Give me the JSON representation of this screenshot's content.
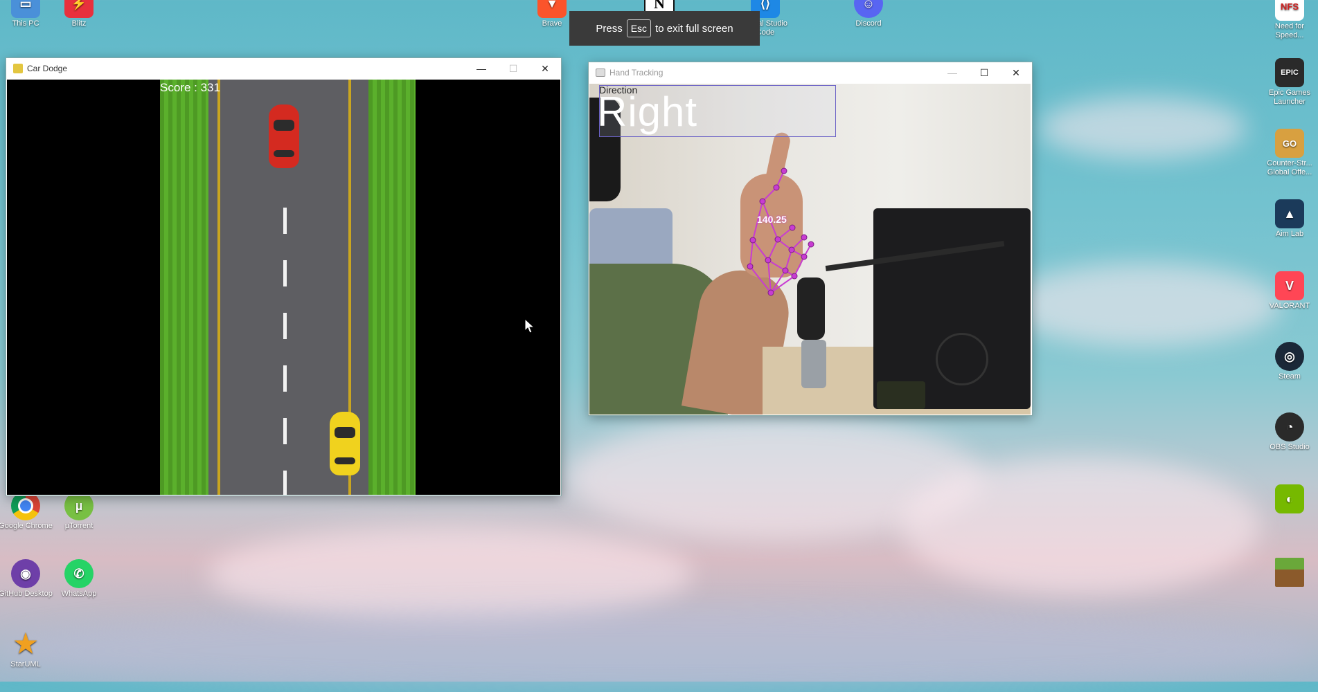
{
  "toast": {
    "press": "Press",
    "key": "Esc",
    "text": "to exit full screen"
  },
  "desktop_icons_left": [
    {
      "label": "This PC",
      "icon": "computer-icon"
    },
    {
      "label": "Blitz",
      "icon": "blitz-icon"
    },
    {
      "label": "Google Chrome",
      "icon": "chrome-icon"
    },
    {
      "label": "µTorrent",
      "icon": "utorrent-icon"
    },
    {
      "label": "GitHub Desktop",
      "icon": "github-icon"
    },
    {
      "label": "WhatsApp",
      "icon": "whatsapp-icon"
    },
    {
      "label": "StarUML",
      "icon": "staruml-icon"
    }
  ],
  "desktop_icons_top": [
    {
      "label": "Brave",
      "icon": "brave-icon"
    },
    {
      "label": "Visual Studio Code",
      "icon": "vscode-icon"
    },
    {
      "label": "Discord",
      "icon": "discord-icon"
    }
  ],
  "desktop_icons_right": [
    {
      "label": "Need for Speed...",
      "icon": "nfs-icon"
    },
    {
      "label": "Epic Games Launcher",
      "icon": "epic-icon"
    },
    {
      "label": "Counter-Str... Global Offe...",
      "icon": "csgo-icon"
    },
    {
      "label": "Aim Lab",
      "icon": "aimlab-icon"
    },
    {
      "label": "VALORANT",
      "icon": "valorant-icon"
    },
    {
      "label": "Steam",
      "icon": "steam-icon"
    },
    {
      "label": "OBS Studio",
      "icon": "obs-icon"
    },
    {
      "label": "",
      "icon": "nvidia-icon"
    },
    {
      "label": "",
      "icon": "minecraft-icon"
    }
  ],
  "game_window": {
    "title": "Car Dodge",
    "score": "Score : 331"
  },
  "tracking_window": {
    "title": "Hand Tracking",
    "direction_label": "Direction",
    "direction_value": "Right",
    "angle": "140.25"
  },
  "colors": {
    "toast_bg": "#3a3a3a",
    "grass": "#5bb02c",
    "road": "#5e5e62",
    "red_car": "#d42a20",
    "yellow_car": "#f0d21e",
    "landmark": "#c83cd2"
  }
}
